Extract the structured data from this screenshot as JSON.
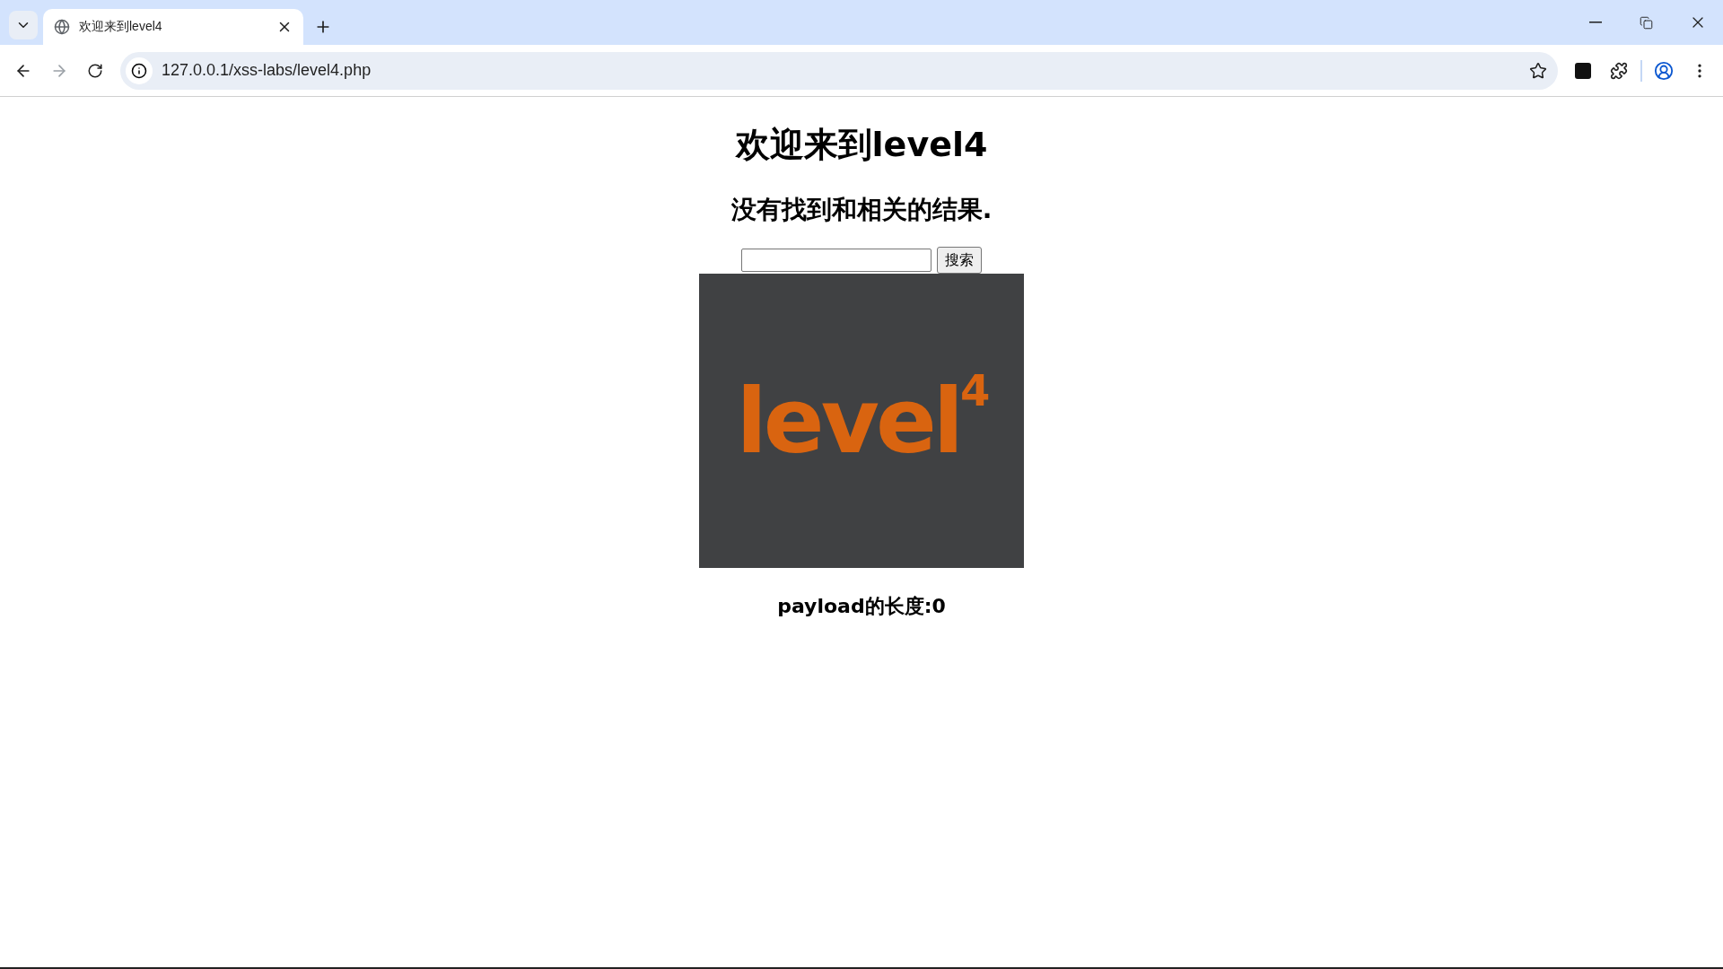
{
  "browser": {
    "tabs": [
      {
        "title": "欢迎来到level4",
        "selected": true
      }
    ],
    "address": "127.0.0.1/xss-labs/level4.php"
  },
  "page": {
    "heading": "欢迎来到level4",
    "result": "没有找到和相关的结果.",
    "search": {
      "button": "搜索"
    },
    "logo": {
      "word": "level",
      "superscript": "4"
    },
    "payload_length": "payload的长度:0"
  }
}
